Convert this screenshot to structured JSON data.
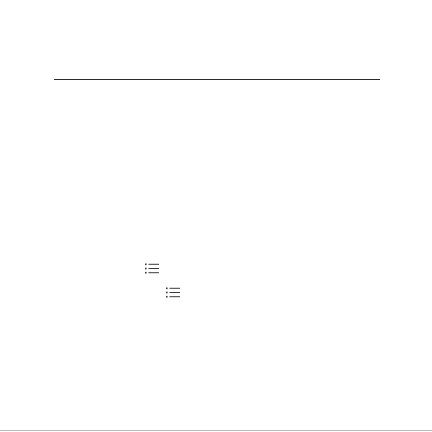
{
  "icons": {
    "list_primary": "list-icon",
    "list_secondary": "list-icon"
  },
  "colors": {
    "background": "#ffffff",
    "rule": "#2b2b2b",
    "icon": "#3a3a3a"
  }
}
